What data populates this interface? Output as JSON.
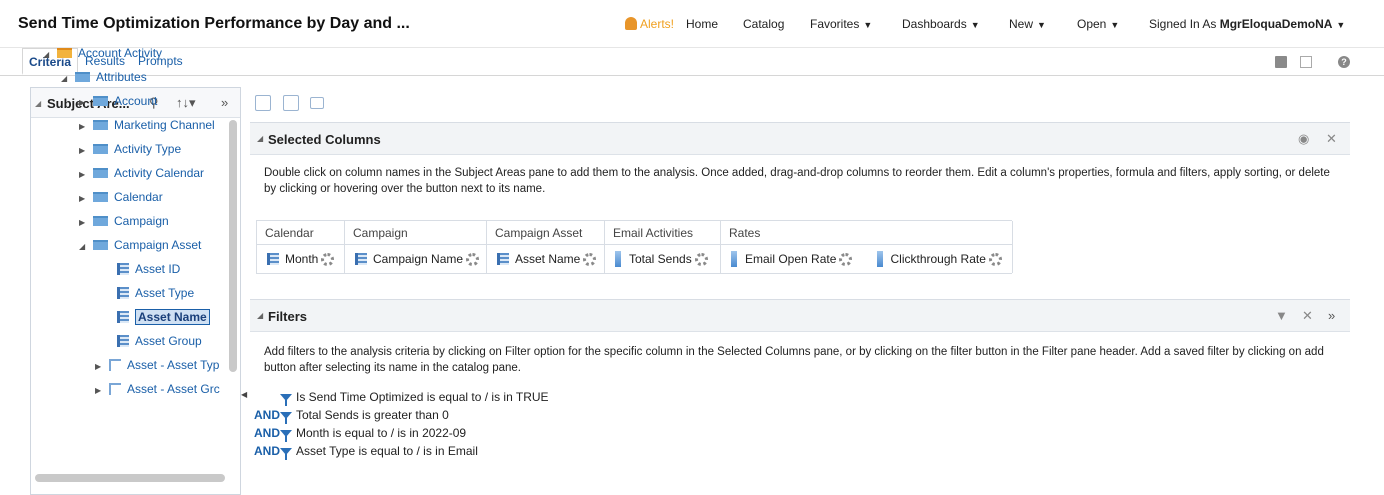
{
  "header": {
    "title": "Send Time Optimization Performance by Day and ...",
    "alerts_label": "Alerts!",
    "nav": [
      {
        "label": "Home",
        "caret": false
      },
      {
        "label": "Catalog",
        "caret": false
      },
      {
        "label": "Favorites",
        "caret": true
      },
      {
        "label": "Dashboards",
        "caret": true
      },
      {
        "label": "New",
        "caret": true
      },
      {
        "label": "Open",
        "caret": true
      }
    ],
    "signed_in_prefix": "Signed In As",
    "user": "MgrEloquaDemoNA"
  },
  "tabs": [
    {
      "label": "Criteria",
      "active": true
    },
    {
      "label": "Results",
      "active": false
    },
    {
      "label": "Prompts",
      "active": false
    }
  ],
  "subject_pane": {
    "title": "Subject Are...",
    "tree": [
      {
        "label": "Account Activity",
        "type": "subject",
        "expanded": true
      },
      {
        "label": "Attributes",
        "type": "folder",
        "expanded": true
      },
      {
        "label": "Account",
        "type": "folder",
        "expanded": false
      },
      {
        "label": "Marketing Channel",
        "type": "folder",
        "expanded": false
      },
      {
        "label": "Activity Type",
        "type": "folder",
        "expanded": false
      },
      {
        "label": "Activity Calendar",
        "type": "folder",
        "expanded": false
      },
      {
        "label": "Calendar",
        "type": "folder",
        "expanded": false
      },
      {
        "label": "Campaign",
        "type": "folder",
        "expanded": false
      },
      {
        "label": "Campaign Asset",
        "type": "folder",
        "expanded": true
      },
      {
        "label": "Asset ID",
        "type": "column"
      },
      {
        "label": "Asset Type",
        "type": "column"
      },
      {
        "label": "Asset Name",
        "type": "column",
        "selected": true
      },
      {
        "label": "Asset Group",
        "type": "column"
      },
      {
        "label": "Asset - Asset Typ",
        "type": "hierarchy"
      },
      {
        "label": "Asset - Asset Grc",
        "type": "hierarchy"
      }
    ]
  },
  "selected_columns": {
    "title": "Selected Columns",
    "description": "Double click on column names in the Subject Areas pane to add them to the analysis. Once added, drag-and-drop columns to reorder them. Edit a column's properties, formula and filters, apply sorting, or delete by clicking or hovering over the button next to its name.",
    "groups": [
      {
        "name": "Calendar",
        "columns": [
          {
            "label": "Month",
            "kind": "attribute"
          }
        ]
      },
      {
        "name": "Campaign",
        "columns": [
          {
            "label": "Campaign Name",
            "kind": "attribute"
          }
        ]
      },
      {
        "name": "Campaign Asset",
        "columns": [
          {
            "label": "Asset Name",
            "kind": "attribute"
          }
        ]
      },
      {
        "name": "Email Activities",
        "columns": [
          {
            "label": "Total Sends",
            "kind": "measure"
          }
        ]
      },
      {
        "name": "Rates",
        "columns": [
          {
            "label": "Email Open Rate",
            "kind": "measure"
          },
          {
            "label": "Clickthrough Rate",
            "kind": "measure"
          }
        ]
      }
    ]
  },
  "filters": {
    "title": "Filters",
    "description": "Add filters to the analysis criteria by clicking on Filter option for the specific column in the Selected Columns pane, or by clicking on the filter button in the Filter pane header. Add a saved filter by clicking on add button after selecting its name in the catalog pane.",
    "items": [
      {
        "connector": "",
        "text": "Is Send Time Optimized is equal to / is in  TRUE"
      },
      {
        "connector": "AND",
        "text": "Total Sends  is greater than  0"
      },
      {
        "connector": "AND",
        "text": "Month is equal to / is in  2022-09"
      },
      {
        "connector": "AND",
        "text": "Asset Type is equal to / is in  Email"
      }
    ]
  }
}
